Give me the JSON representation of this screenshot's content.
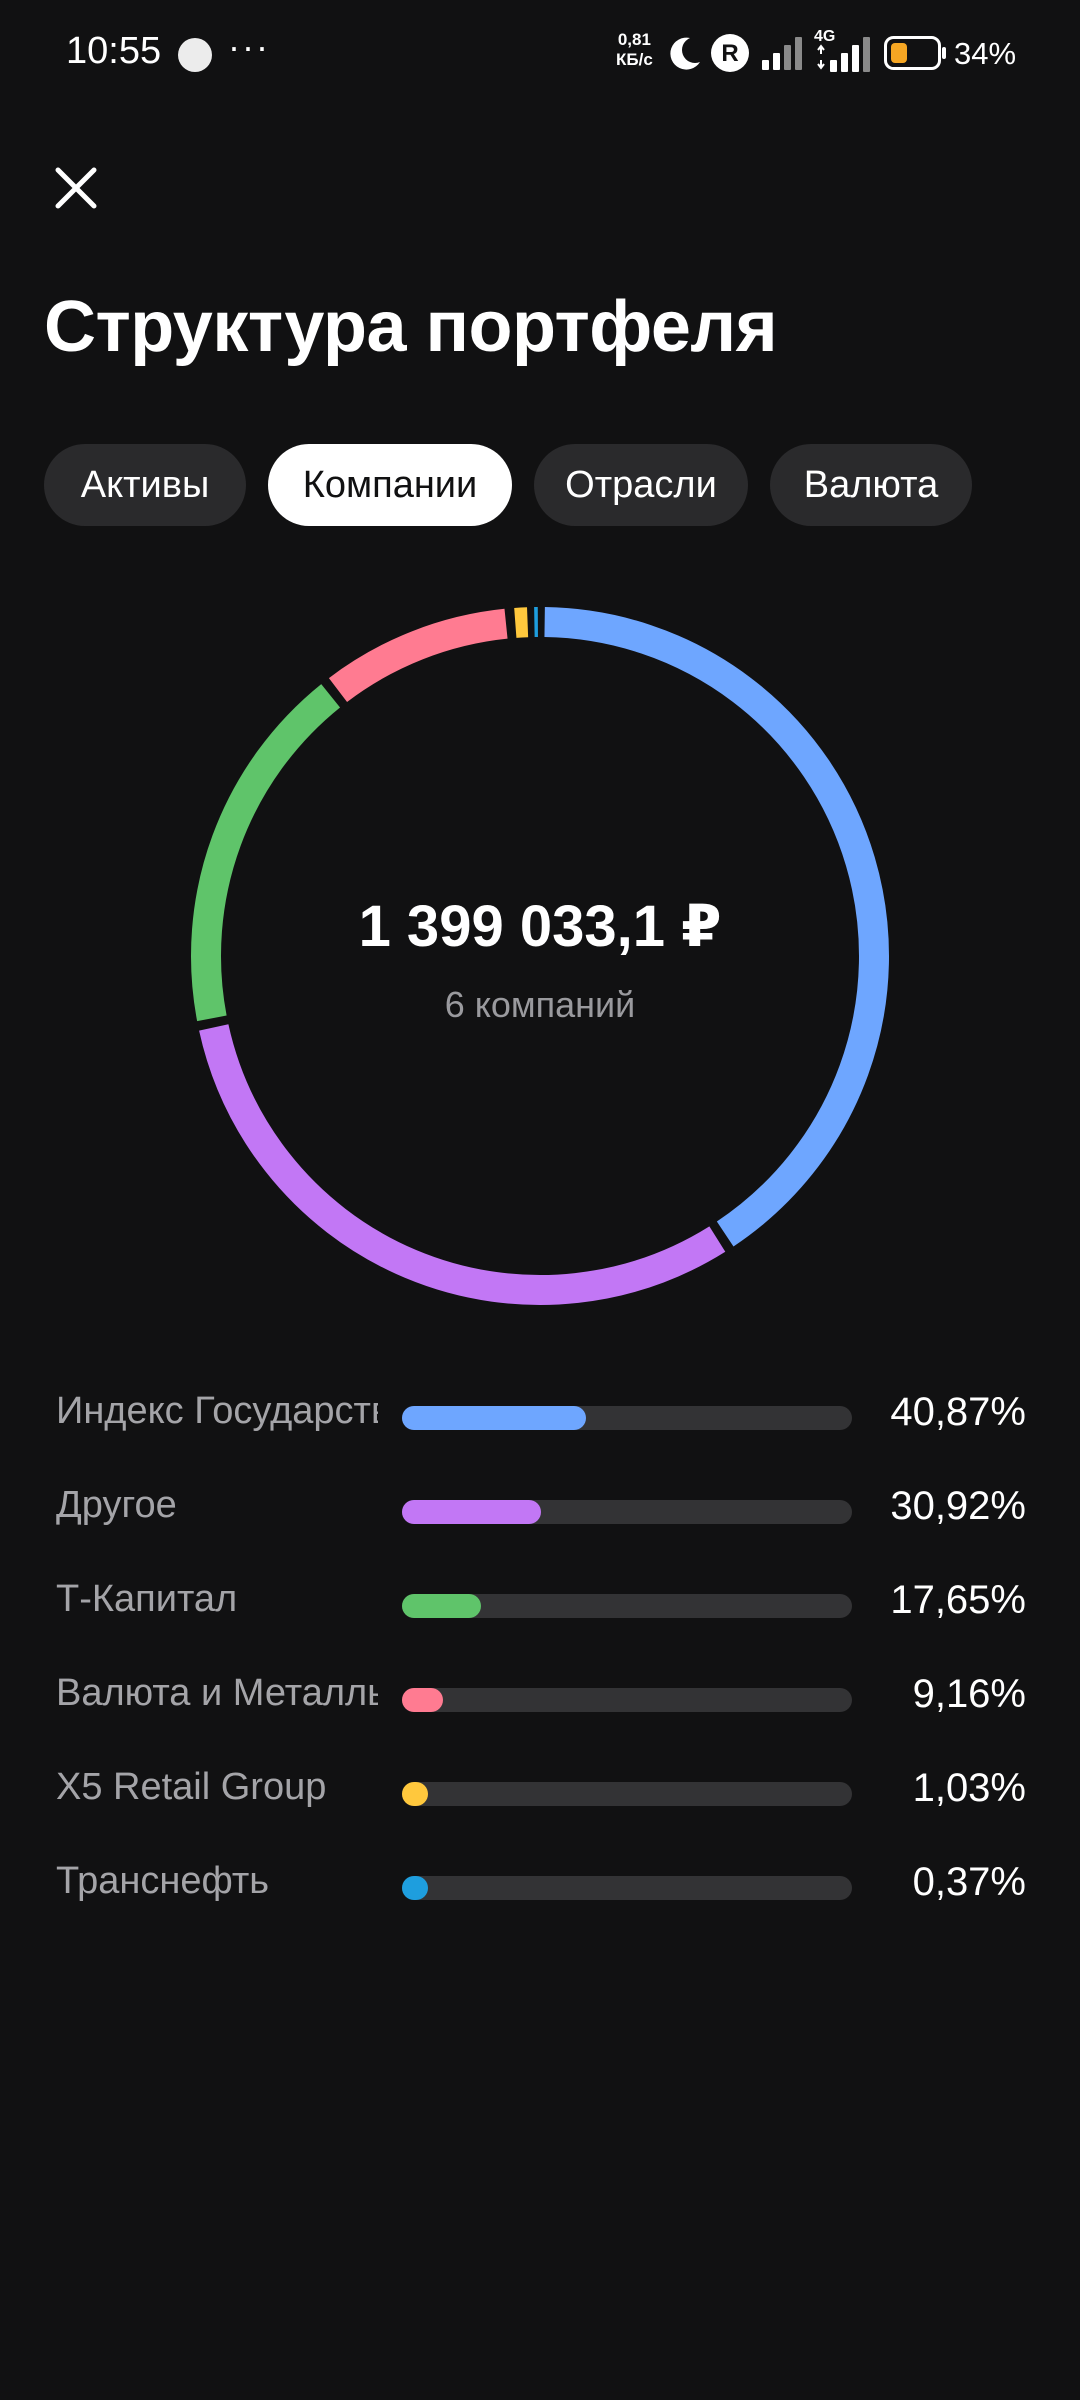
{
  "status_bar": {
    "time": "10:55",
    "more": "···",
    "speed_value": "0,81",
    "speed_unit": "КБ/с",
    "network": "4G",
    "battery": "34%",
    "icons": [
      "moon-icon",
      "r-badge-icon",
      "signal-icon",
      "signal-4g-icon",
      "battery-icon"
    ],
    "battery_color": "#f5a623"
  },
  "header": {
    "close_icon": "close-icon",
    "title": "Структура портфеля"
  },
  "tabs": [
    {
      "label": "Активы",
      "active": false
    },
    {
      "label": "Компании",
      "active": true
    },
    {
      "label": "Отрасли",
      "active": false
    },
    {
      "label": "Валюта",
      "active": false
    }
  ],
  "summary": {
    "total": "1 399 033,1 ₽",
    "count_label": "6 компаний"
  },
  "chart_data": {
    "type": "pie",
    "variant": "donut",
    "categories": [
      "Индекс Государственных облигаций",
      "Другое",
      "Т-Капитал",
      "Валюта и Металлы",
      "X5 Retail Group",
      "Транснефть"
    ],
    "values": [
      40.87,
      30.92,
      17.65,
      9.16,
      1.03,
      0.37
    ],
    "colors": [
      "#6ea6ff",
      "#c277f5",
      "#5fc46a",
      "#ff7b91",
      "#ffc83d",
      "#1e9ede"
    ],
    "unit": "%"
  },
  "legend": [
    {
      "name": "Индекс Государственных облигаций",
      "percent": "40,87%",
      "value": 40.87,
      "color": "#6ea6ff"
    },
    {
      "name": "Другое",
      "percent": "30,92%",
      "value": 30.92,
      "color": "#c277f5"
    },
    {
      "name": "Т-Капитал",
      "percent": "17,65%",
      "value": 17.65,
      "color": "#5fc46a"
    },
    {
      "name": "Валюта и Металлы",
      "percent": "9,16%",
      "value": 9.16,
      "color": "#ff7b91"
    },
    {
      "name": "X5 Retail Group",
      "percent": "1,03%",
      "value": 1.03,
      "color": "#ffc83d"
    },
    {
      "name": "Транснефть",
      "percent": "0,37%",
      "value": 0.37,
      "color": "#1e9ede"
    }
  ]
}
